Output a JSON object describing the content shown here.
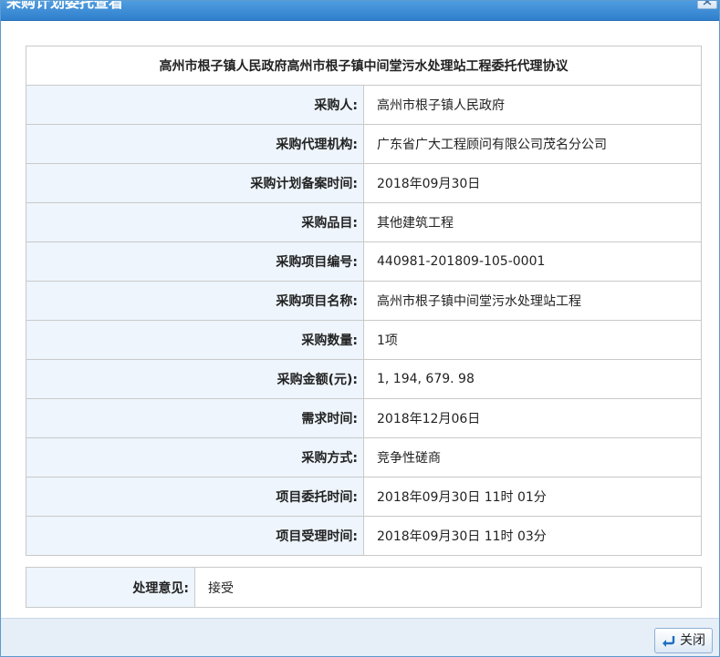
{
  "window": {
    "title": "采购计划委托查看"
  },
  "table": {
    "heading": "高州市根子镇人民政府高州市根子镇中间堂污水处理站工程委托代理协议",
    "rows": [
      {
        "label": "采购人:",
        "value": "高州市根子镇人民政府"
      },
      {
        "label": "采购代理机构:",
        "value": "广东省广大工程顾问有限公司茂名分公司"
      },
      {
        "label": "采购计划备案时间:",
        "value": "2018年09月30日"
      },
      {
        "label": "采购品目:",
        "value": "其他建筑工程"
      },
      {
        "label": "采购项目编号:",
        "value": "440981-201809-105-0001"
      },
      {
        "label": "采购项目名称:",
        "value": "高州市根子镇中间堂污水处理站工程"
      },
      {
        "label": "采购数量:",
        "value": "1项"
      },
      {
        "label": "采购金额(元):",
        "value": "1, 194, 679. 98"
      },
      {
        "label": "需求时间:",
        "value": "2018年12月06日"
      },
      {
        "label": "采购方式:",
        "value": "竞争性磋商"
      },
      {
        "label": "项目委托时间:",
        "value": "2018年09月30日  11时 01分"
      },
      {
        "label": "项目受理时间:",
        "value": "2018年09月30日  11时 03分"
      }
    ]
  },
  "opinion": {
    "label": "处理意见:",
    "value": "接受"
  },
  "footer": {
    "close_label": "关闭"
  },
  "icons": {
    "window_close": "close-icon",
    "return": "return-arrow-icon"
  },
  "colors": {
    "titlebar": "#3a8ad6",
    "label_bg": "#eef5fc",
    "border": "#c9c9c9",
    "footer_bg": "#e6eef7"
  }
}
